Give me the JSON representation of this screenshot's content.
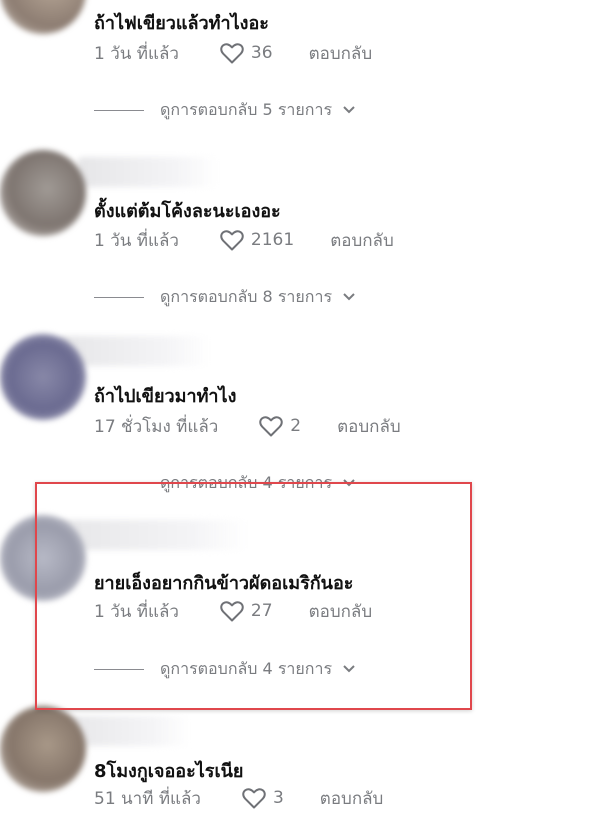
{
  "comments": [
    {
      "text": "ถ้าไฟเขียวแล้วทำไงอะ",
      "time": "1 วัน ที่แล้ว",
      "likes": "36",
      "reply_label": "ตอบกลับ",
      "view_replies": "ดูการตอบกลับ 5 รายการ"
    },
    {
      "text": "ตั้งแต่ต้มโค้งละนะเองอะ",
      "time": "1 วัน ที่แล้ว",
      "likes": "2161",
      "reply_label": "ตอบกลับ",
      "view_replies": "ดูการตอบกลับ 8 รายการ"
    },
    {
      "text": "ถ้าไปเขียวมาทำไง",
      "time": "17 ชั่วโมง ที่แล้ว",
      "likes": "2",
      "reply_label": "ตอบกลับ",
      "view_replies": "ดูการตอบกลับ 4 รายการ"
    },
    {
      "text": "ยายเอ็งอยากกินข้าวผัดอเมริกันอะ",
      "time": "1 วัน ที่แล้ว",
      "likes": "27",
      "reply_label": "ตอบกลับ",
      "view_replies": "ดูการตอบกลับ 4 รายการ"
    },
    {
      "text": "8โมงกูเจออะไรเนีย",
      "time": "51 นาที ที่แล้ว",
      "likes": "3",
      "reply_label": "ตอบกลับ"
    }
  ],
  "icons": {
    "like": "heart-outline-icon",
    "expand": "chevron-down-icon"
  },
  "colors": {
    "text": "#161823",
    "muted": "#7a7c80",
    "highlight_border": "#e0474c"
  }
}
